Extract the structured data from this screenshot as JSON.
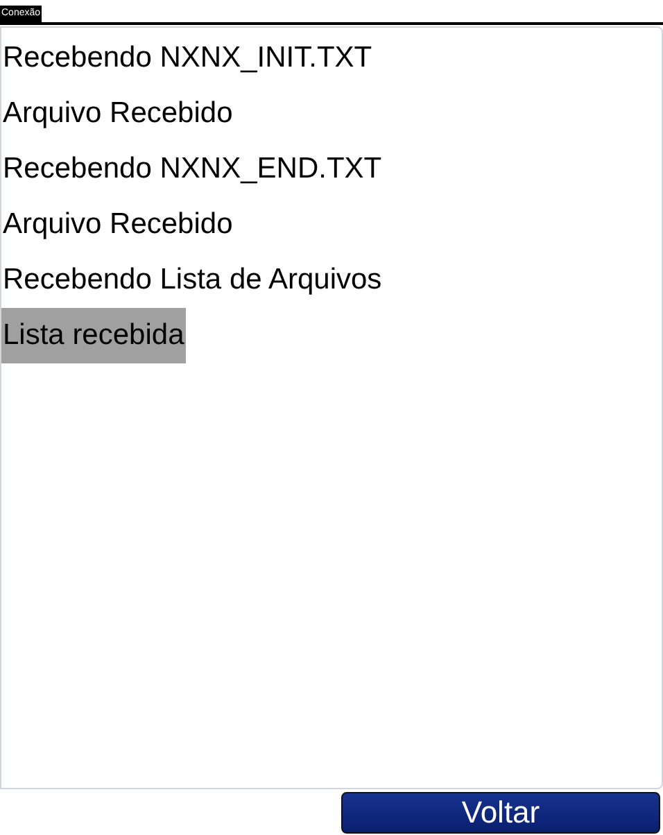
{
  "window": {
    "title": "Conexão"
  },
  "log": [
    {
      "text": "Recebendo NXNX_INIT.TXT",
      "selected": false
    },
    {
      "text": "Arquivo Recebido",
      "selected": false
    },
    {
      "text": "Recebendo NXNX_END.TXT",
      "selected": false
    },
    {
      "text": "Arquivo Recebido",
      "selected": false
    },
    {
      "text": "Recebendo Lista de Arquivos",
      "selected": false
    },
    {
      "text": "Lista recebida",
      "selected": true
    }
  ],
  "buttons": [
    "Voltar"
  ]
}
